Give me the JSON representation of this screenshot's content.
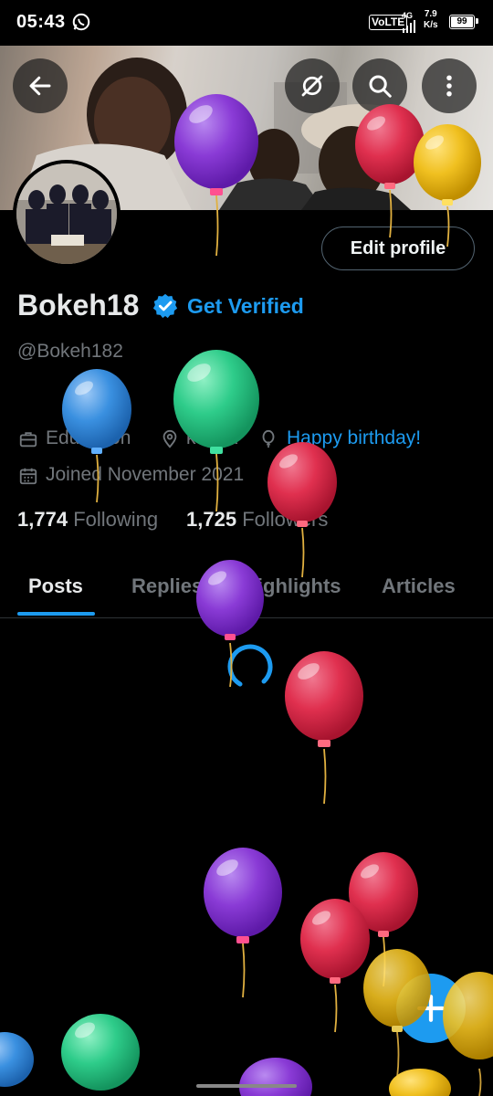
{
  "status_bar": {
    "time": "05:43",
    "network": "VoLTE",
    "net_type": "4G",
    "speed_value": "7.9",
    "speed_unit": "K/s",
    "battery": "99"
  },
  "header": {
    "back_icon": "arrow-left-icon",
    "sync_icon": "no-sync-icon",
    "search_icon": "search-icon",
    "more_icon": "more-vertical-icon"
  },
  "profile": {
    "edit_label": "Edit profile",
    "name": "Bokeh18",
    "get_verified": "Get Verified",
    "handle": "@Bokeh182",
    "category": "Education",
    "location": "kenya",
    "birthday": "Happy birthday!",
    "joined": "Joined November 2021",
    "following_count": "1,774",
    "following_label": "Following",
    "followers_count": "1,725",
    "followers_label": "Followers"
  },
  "tabs": [
    {
      "label": "Posts",
      "active": true
    },
    {
      "label": "Replies",
      "active": false
    },
    {
      "label": "Highlights",
      "active": false
    },
    {
      "label": "Articles",
      "active": false
    }
  ],
  "colors": {
    "accent": "#1d9bf0",
    "background": "#000000",
    "muted": "#71767b",
    "balloon_purple": "#8a3bd6",
    "balloon_red": "#e0304f",
    "balloon_yellow": "#f0c020",
    "balloon_green": "#2ecc8a",
    "balloon_blue": "#3a90e0"
  },
  "fab_icon": "plus-icon"
}
